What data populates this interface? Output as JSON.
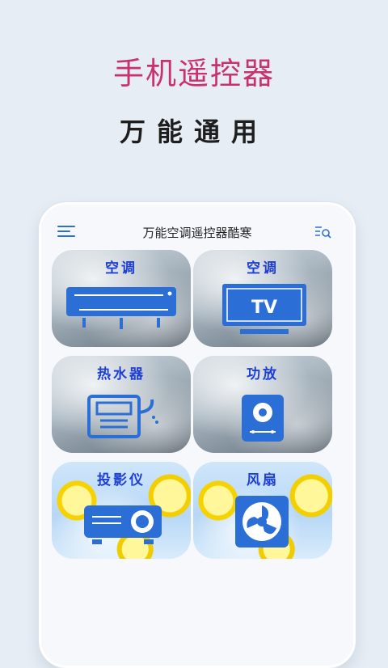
{
  "promo": {
    "headline": "手机遥控器",
    "subline": "万能通用"
  },
  "app": {
    "title": "万能空调遥控器酷寒",
    "icons": {
      "left": "menu-icon",
      "right": "search-list-icon"
    }
  },
  "tiles": [
    {
      "label": "空调",
      "icon": "air-conditioner-icon",
      "background": "frost"
    },
    {
      "label": "空调",
      "icon": "tv-icon",
      "icon_text": "TV",
      "background": "frost"
    },
    {
      "label": "热水器",
      "icon": "water-heater-icon",
      "background": "frost"
    },
    {
      "label": "功放",
      "icon": "amplifier-icon",
      "background": "frost"
    },
    {
      "label": "投影仪",
      "icon": "projector-icon",
      "background": "lemon"
    },
    {
      "label": "风扇",
      "icon": "fan-icon",
      "background": "lemon"
    }
  ],
  "colors": {
    "accent": "#c8326e",
    "icon_blue": "#2b6fd6",
    "label_blue": "#1e3fd6",
    "background": "#e6edf5"
  }
}
